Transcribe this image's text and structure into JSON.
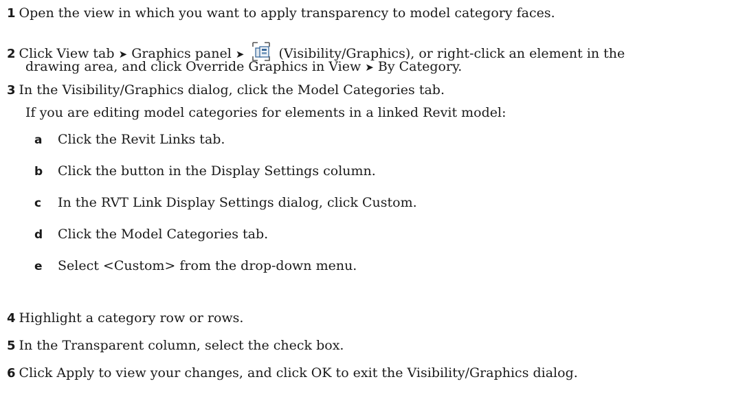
{
  "steps": [
    {
      "num": "1",
      "text": "Open the view in which you want to apply transparency to model category faces."
    },
    {
      "num": "2",
      "part_a": "Click View tab",
      "part_b": "Graphics panel",
      "part_c": "(Visibility/Graphics), or right-click an element in the",
      "line2_a": "drawing area, and click Override Graphics in View",
      "line2_b": "By Category.",
      "arrow": "➤",
      "icon": "visibility-graphics-icon"
    },
    {
      "num": "3",
      "text": "In the Visibility/Graphics dialog, click the Model Categories tab.",
      "note": "If you are editing model categories for elements in a linked Revit model:"
    },
    {
      "num": "4",
      "text": "Highlight a category row or rows."
    },
    {
      "num": "5",
      "text": "In the Transparent column, select the check box."
    },
    {
      "num": "6",
      "text": "Click Apply to view your changes, and click OK to exit the Visibility/Graphics dialog."
    }
  ],
  "substeps": [
    {
      "letter": "a",
      "text": "Click the Revit Links tab."
    },
    {
      "letter": "b",
      "text": "Click the button in the Display Settings column."
    },
    {
      "letter": "c",
      "text": "In the RVT Link Display Settings dialog, click Custom."
    },
    {
      "letter": "d",
      "text": "Click the Model Categories tab."
    },
    {
      "letter": "e",
      "text": "Select <Custom> from the drop-down menu."
    }
  ]
}
